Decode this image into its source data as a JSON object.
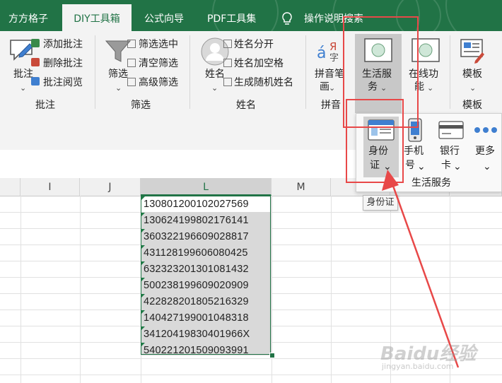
{
  "tabs": [
    {
      "label": "方方格子",
      "active": false
    },
    {
      "label": "DIY工具箱",
      "active": true
    },
    {
      "label": "公式向导",
      "active": false
    },
    {
      "label": "PDF工具集",
      "active": false
    },
    {
      "label": "操作说明搜索",
      "active": false
    }
  ],
  "ribbon": {
    "annotation": {
      "big_label": "批注",
      "items": [
        "添加批注",
        "删除批注",
        "批注阅览"
      ],
      "group_label": "批注"
    },
    "filter": {
      "big_label": "筛选",
      "items": [
        "筛选选中",
        "清空筛选",
        "高级筛选"
      ],
      "group_label": "筛选"
    },
    "name": {
      "big_label": "姓名",
      "items": [
        "姓名分开",
        "姓名加空格",
        "生成随机姓名"
      ],
      "group_label": "姓名"
    },
    "pinyin": {
      "label_line1": "拼音笔",
      "label_line2": "画",
      "group_label": "拼音"
    },
    "life_service": {
      "label_line1": "生活服",
      "label_line2": "务"
    },
    "online": {
      "label_line1": "在线功",
      "label_line2": "能"
    },
    "template": {
      "label": "模板",
      "group_label": "模板"
    }
  },
  "gallery": {
    "items": [
      {
        "line1": "身份",
        "line2": "证"
      },
      {
        "line1": "手机",
        "line2": "号"
      },
      {
        "line1": "银行",
        "line2": "卡"
      },
      {
        "line1": "更多",
        "line2": ""
      }
    ],
    "group_label": "生活服务",
    "tooltip": "身份证"
  },
  "sheet": {
    "columns": [
      "I",
      "J",
      "L",
      "M"
    ],
    "selected_column": "L",
    "cells": [
      "130801200102027569",
      "130624199802176141",
      "360322196609028817",
      "431128199606080425",
      "632323201301081432",
      "500238199609020909",
      "422828201805216329",
      "140427199001048318",
      "3412041983040196​6X",
      "540221201509093991"
    ]
  },
  "colors": {
    "accent": "#217346",
    "highlight_box": "#e84848"
  }
}
